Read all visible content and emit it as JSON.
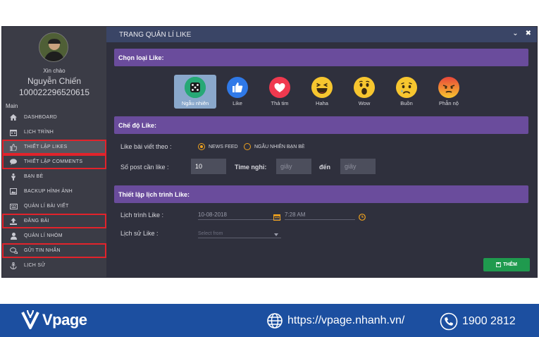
{
  "window": {
    "title": "TRANG QUẢN LÍ LIKE",
    "minimize": "⌄",
    "close": "✖"
  },
  "user": {
    "greeting": "Xin chào",
    "name": "Nguyễn Chiến",
    "id": "100022296520615"
  },
  "sidebar": {
    "section": "Main",
    "items": [
      {
        "label": "DASHBOARD",
        "icon": "home-icon"
      },
      {
        "label": "LỊCH TRÌNH",
        "icon": "calendar-icon"
      },
      {
        "label": "THIẾT LẬP LIKES",
        "icon": "thumbs-up-icon"
      },
      {
        "label": "THIẾT LẬP COMMENTS",
        "icon": "comment-icon"
      },
      {
        "label": "BẠN BÈ",
        "icon": "person-icon"
      },
      {
        "label": "BACKUP HÌNH ẢNH",
        "icon": "image-icon"
      },
      {
        "label": "QUẢN LÍ BÀI VIẾT",
        "icon": "keyboard-icon"
      },
      {
        "label": "ĐĂNG BÀI",
        "icon": "upload-icon"
      },
      {
        "label": "QUẢN LÍ NHÓM",
        "icon": "user-icon"
      },
      {
        "label": "GỬI TIN NHẮN",
        "icon": "chat-icon"
      },
      {
        "label": "LỊCH SỬ",
        "icon": "anchor-icon"
      }
    ]
  },
  "like_type": {
    "heading": "Chọn loại Like:",
    "options": [
      {
        "label": "Ngẫu nhiên",
        "icon": "dice-icon"
      },
      {
        "label": "Like",
        "icon": "like-icon"
      },
      {
        "label": "Thả tim",
        "icon": "heart-icon"
      },
      {
        "label": "Haha",
        "icon": "haha-icon"
      },
      {
        "label": "Wow",
        "icon": "wow-icon"
      },
      {
        "label": "Buồn",
        "icon": "sad-icon"
      },
      {
        "label": "Phẫn nộ",
        "icon": "angry-icon"
      }
    ],
    "selected": "Ngẫu nhiên"
  },
  "mode": {
    "heading": "Chế độ Like:",
    "follow_label": "Like bài viết theo :",
    "radio_newsfeed": "NEWS FEED",
    "radio_random_friends": "NGẪU NHIÊN BẠN BÈ",
    "post_count_label": "Số post cần like :",
    "post_count_value": "10",
    "rest_label": "Time nghỉ:",
    "rest_from_placeholder": "giây",
    "to_label": "đến",
    "rest_to_placeholder": "giây"
  },
  "schedule": {
    "heading": "Thiết lập lịch trình Like:",
    "schedule_label": "Lịch trình Like :",
    "date_value": "10-08-2018",
    "time_value": "7:28 AM",
    "history_label": "Lịch sử Like :",
    "history_placeholder": "Select from"
  },
  "actions": {
    "add_label": "THÊM"
  },
  "footer": {
    "brand": "Vpage",
    "url": "https://vpage.nhanh.vn/",
    "phone": "1900 2812"
  },
  "colors": {
    "panel_header": "#6a4c9c",
    "accent": "#f0a21e",
    "add_button": "#1f9a4e",
    "banner": "#1c4fa0",
    "highlight": "#e2232b"
  }
}
